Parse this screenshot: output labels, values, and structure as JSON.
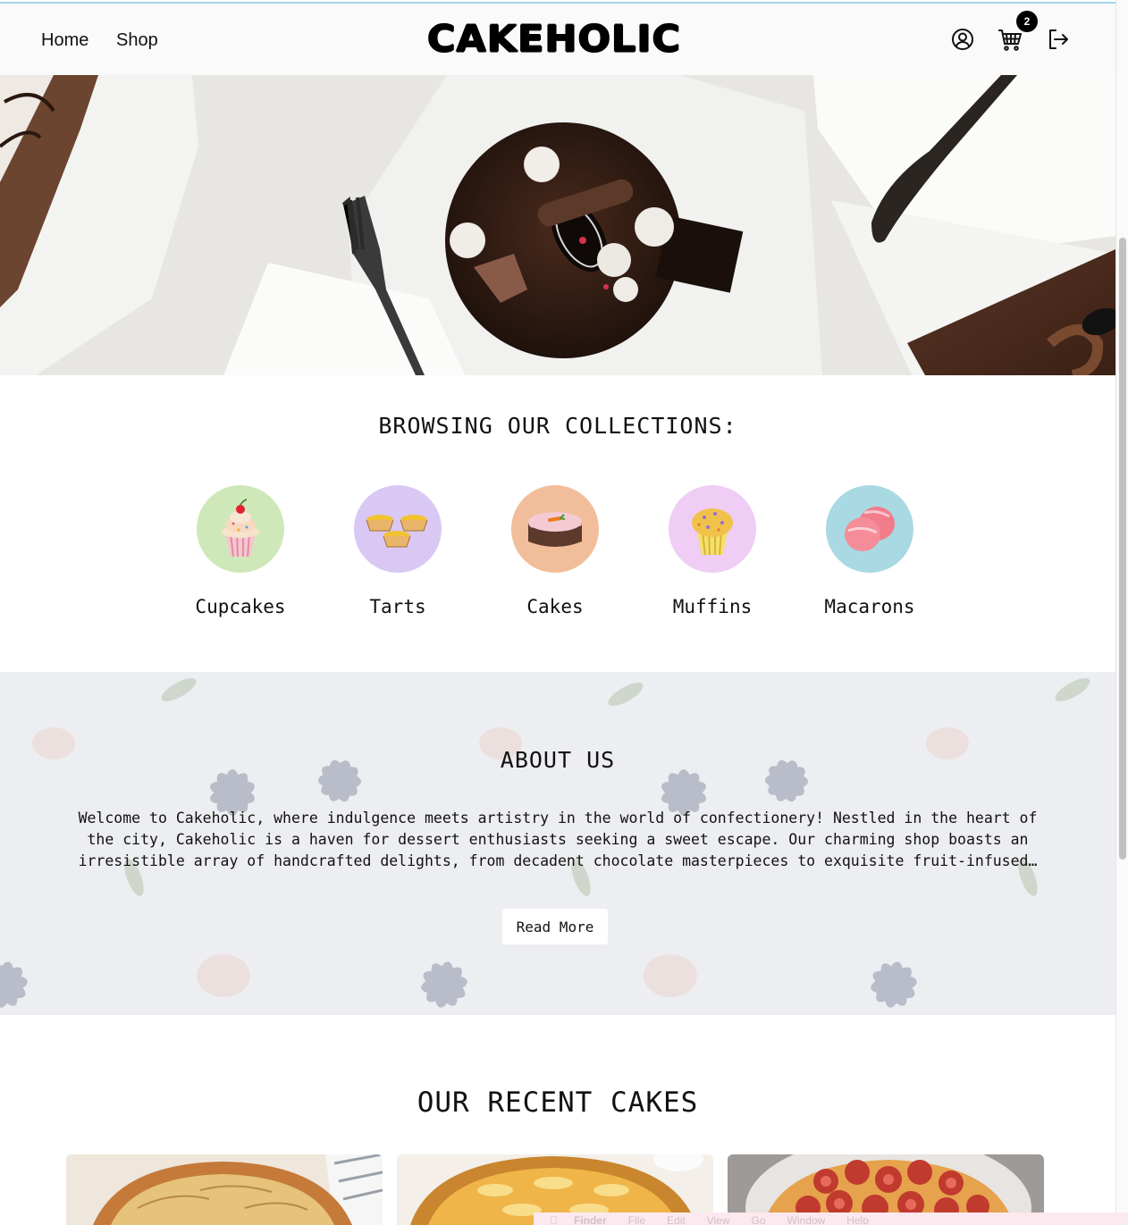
{
  "nav": {
    "home": "Home",
    "shop": "Shop",
    "logo": "CAKEHOLIC",
    "cart_count": "2",
    "icons": [
      "user-circle-icon",
      "cart-icon",
      "logout-icon"
    ]
  },
  "collections": {
    "title": "BROWSING OUR COLLECTIONS:",
    "items": [
      {
        "label": "Cupcakes",
        "color": "#cfe8b9"
      },
      {
        "label": "Tarts",
        "color": "#d9c8f3"
      },
      {
        "label": "Cakes",
        "color": "#f2bd9a"
      },
      {
        "label": "Muffins",
        "color": "#efcdf5"
      },
      {
        "label": "Macarons",
        "color": "#a9d9e2"
      }
    ]
  },
  "about": {
    "title": "ABOUT US",
    "text": "Welcome to Cakeholic, where indulgence meets artistry in the world of confectionery! Nestled in the heart of the city, Cakeholic is a haven for dessert enthusiasts seeking a sweet escape. Our charming shop boasts an irresistible array of handcrafted delights, from decadent chocolate masterpieces to exquisite fruit-infused…",
    "button": "Read More"
  },
  "recent": {
    "title": "OUR RECENT CAKES"
  },
  "menubar": {
    "items": [
      "Finder",
      "File",
      "Edit",
      "View",
      "Go",
      "Window",
      "Help"
    ]
  }
}
